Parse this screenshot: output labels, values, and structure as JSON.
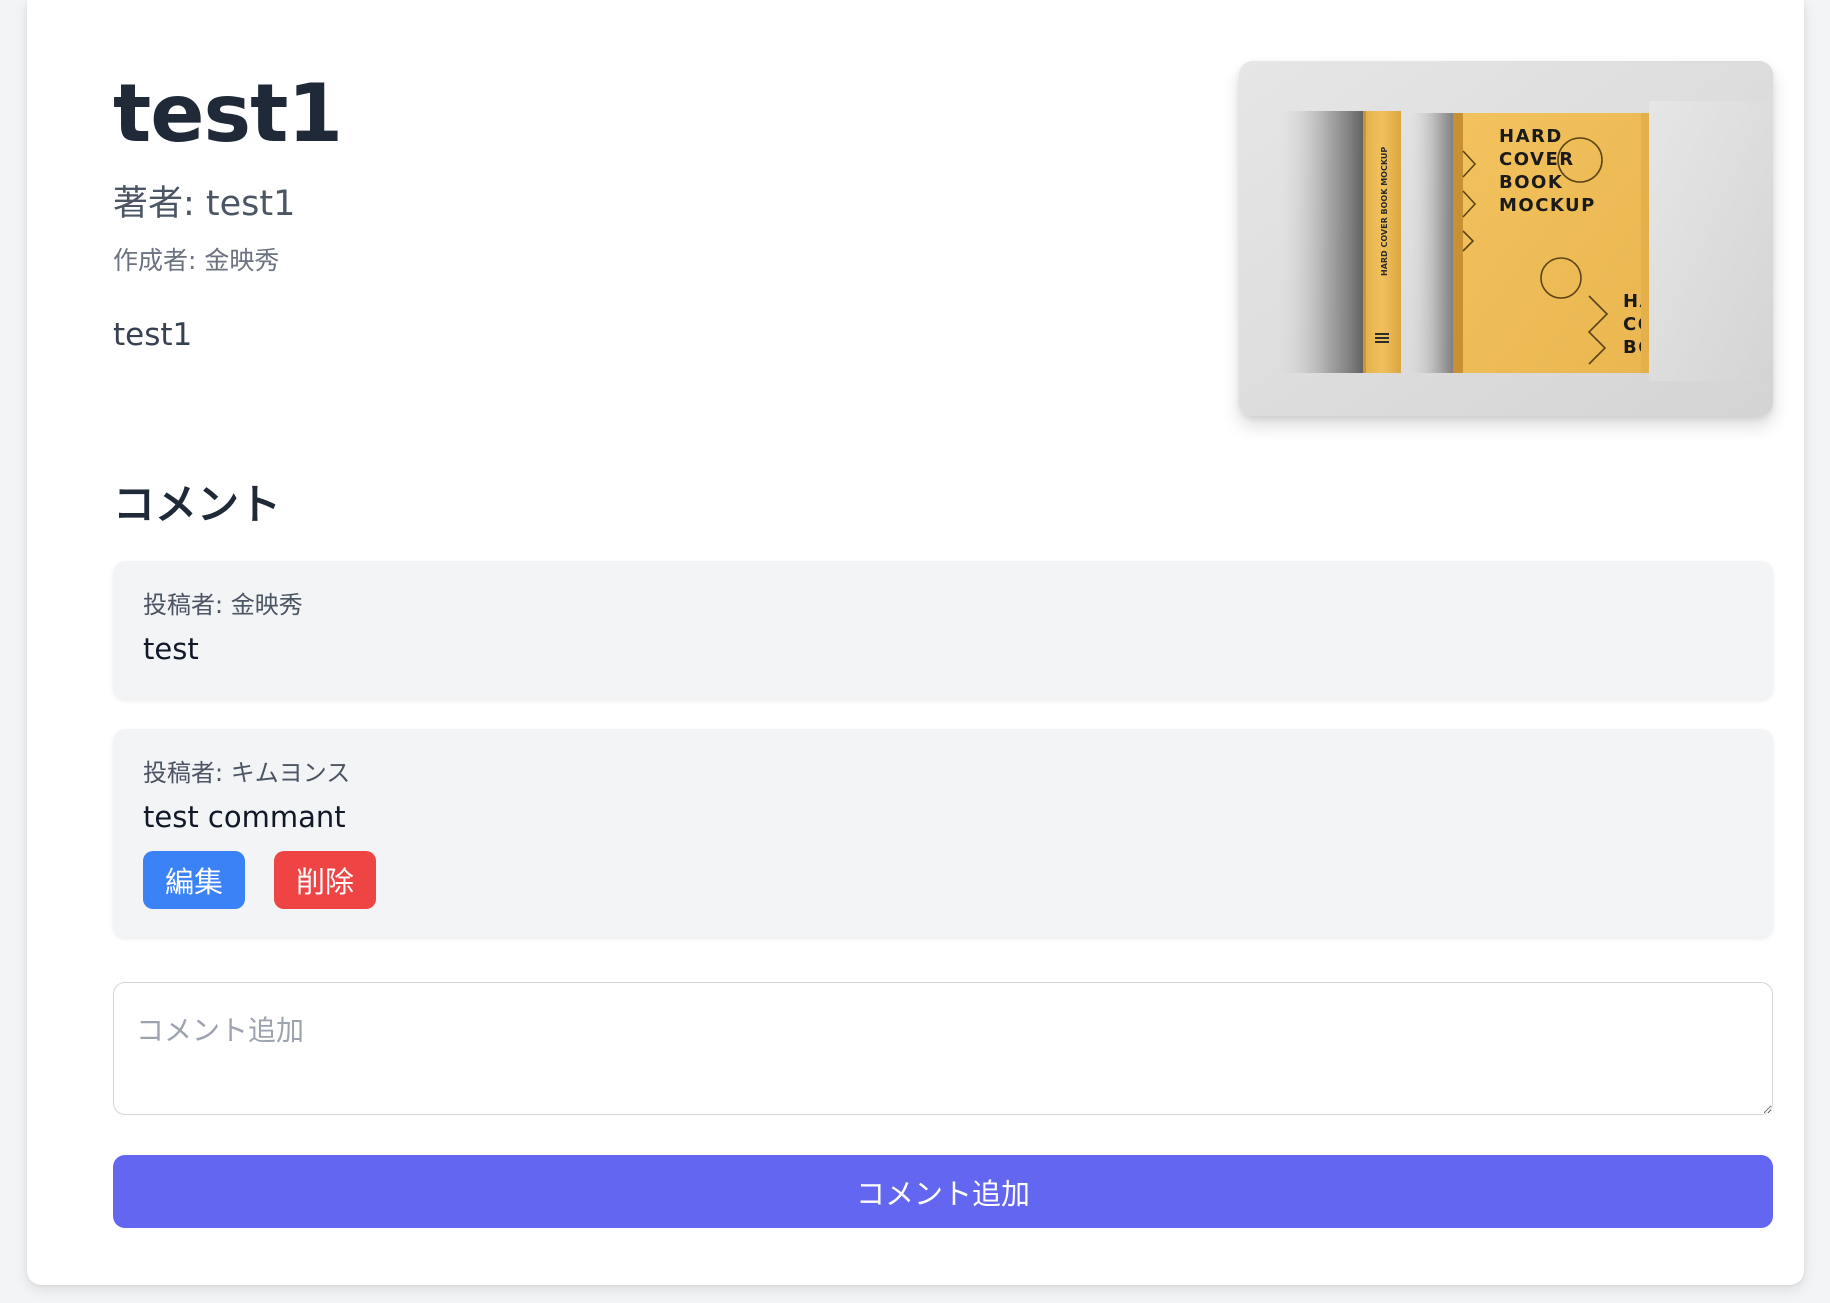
{
  "book": {
    "title": "test1",
    "author": "著者: test1",
    "creator": "作成者: 金映秀",
    "description": "test1",
    "image": {
      "cover_lines": [
        "HARD",
        "COVER",
        "BOOK",
        "MOCKUP"
      ],
      "back_cover_lines": [
        "HA",
        "CO",
        "BO"
      ],
      "spine_text": "HARD COVER BOOK MOCKUP",
      "cover_color": "#eebd57",
      "background_color": "#dcdcdc"
    }
  },
  "comments": {
    "heading": "コメント",
    "items": [
      {
        "poster": "投稿者: 金映秀",
        "text": "test"
      },
      {
        "poster": "投稿者: キムヨンス",
        "text": "test commant",
        "edit_label": "編集",
        "delete_label": "削除"
      }
    ]
  },
  "new_comment": {
    "placeholder": "コメント追加",
    "value": "",
    "submit_label": "コメント追加"
  },
  "colors": {
    "edit_button": "#3b82f6",
    "delete_button": "#ef4444",
    "submit_button": "#6366f1"
  }
}
